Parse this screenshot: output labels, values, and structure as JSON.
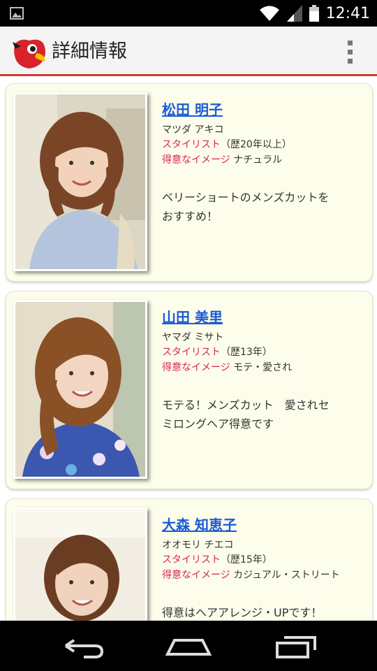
{
  "status_bar": {
    "time": "12:41"
  },
  "header": {
    "title": "詳細情報"
  },
  "stylists": [
    {
      "name": "松田 明子",
      "kana": "マツダ アキコ",
      "role_label": "スタイリスト",
      "experience": "（歴20年以上）",
      "image_label": "得意なイメージ",
      "image_value": " ナチュラル",
      "comment_lines": [
        "ベリーショートのメンズカットを",
        "おすすめ！"
      ]
    },
    {
      "name": "山田 美里",
      "kana": "ヤマダ ミサト",
      "role_label": "スタイリスト",
      "experience": "（歴13年）",
      "image_label": "得意なイメージ",
      "image_value": " モテ・愛され",
      "comment_lines": [
        "モテる！メンズカット　愛されセ",
        "ミロングヘア得意です"
      ]
    },
    {
      "name": "大森 知恵子",
      "kana": "オオモリ チエコ",
      "role_label": "スタイリスト",
      "experience": "（歴15年）",
      "image_label": "得意なイメージ",
      "image_value": " カジュアル・ストリート",
      "comment_lines": [
        "得意はヘアアレンジ・UPです！",
        ""
      ]
    }
  ]
}
